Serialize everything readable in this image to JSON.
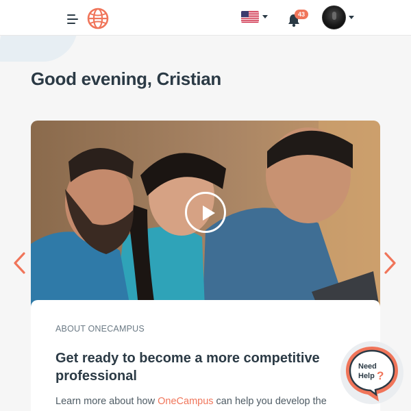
{
  "header": {
    "menu_icon": "hamburger-menu-icon",
    "logo_icon": "globe-logo-icon",
    "language_icon": "us-flag-icon",
    "notifications": {
      "icon": "bell-icon",
      "count": "43"
    },
    "user_icon": "avatar"
  },
  "greeting": "Good evening, Cristian",
  "carousel": {
    "play_icon": "play-icon",
    "kicker": "ABOUT ONECAMPUS",
    "title": "Get ready to become a more competitive professional",
    "text_before": "Learn more about how ",
    "text_link": "OneCampus",
    "text_after": " can help you develop the"
  },
  "help": {
    "line1": "Need",
    "line2": "Help",
    "mark": "?"
  },
  "colors": {
    "accent": "#f0755a",
    "text_dark": "#2b3a45",
    "background": "#f6f6f6"
  }
}
